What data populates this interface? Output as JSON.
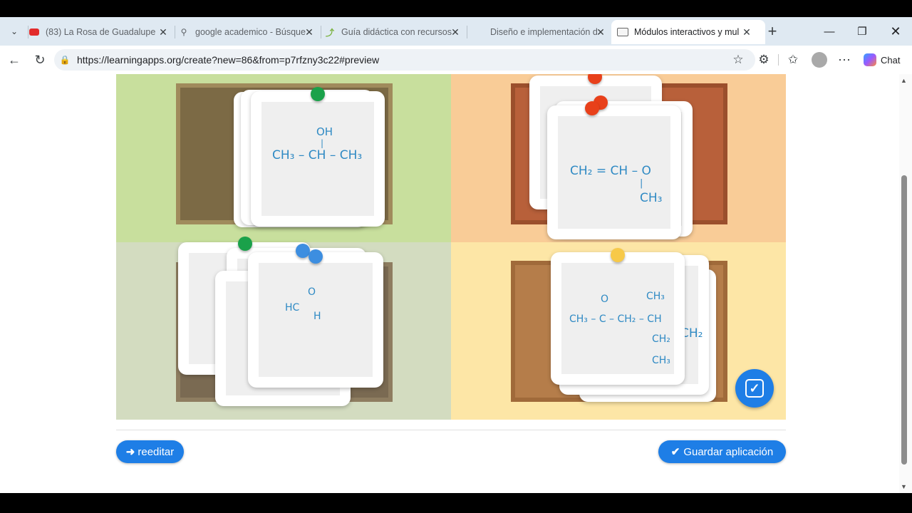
{
  "browser": {
    "tabs": [
      {
        "title": "(83) La Rosa de Guadalupe",
        "icon": "youtube-icon"
      },
      {
        "title": "google academico - Búsque",
        "icon": "search-icon"
      },
      {
        "title": "Guía didáctica con recursos",
        "icon": "link-icon"
      },
      {
        "title": "Diseño e implementación d",
        "icon": "blank-icon"
      },
      {
        "title": "Módulos interactivos y mul",
        "icon": "app-icon",
        "active": true
      }
    ],
    "url": "https://learningapps.org/create?new=86&from=p7rfzny3c22#preview",
    "chat_label": "Chat"
  },
  "app": {
    "cards": {
      "top_left": {
        "line1": "OH",
        "line2": "CH₃ – CH – CH₃"
      },
      "top_right": {
        "line1": "CH₂ = CH – O",
        "line2": "CH₃"
      },
      "bottom_left": {
        "h_o": "O",
        "h_c": "HC",
        "h_h": "H"
      },
      "bottom_right": {
        "o": "O",
        "ch3_top": "CH₃",
        "main": "CH₃ – C – CH₂ – CH",
        "ch2": "CH₂",
        "ch3_bot": "CH₃",
        "side": "CH₂"
      }
    },
    "buttons": {
      "reedit": "reeditar",
      "save": "Guardar aplicación"
    },
    "colors": {
      "green_bg": "#c8df9d",
      "orange_bg": "#f9cc97",
      "sage_bg": "#d3dcc0",
      "yellow_bg": "#fde6a6",
      "button_blue": "#1e7ee6"
    }
  }
}
